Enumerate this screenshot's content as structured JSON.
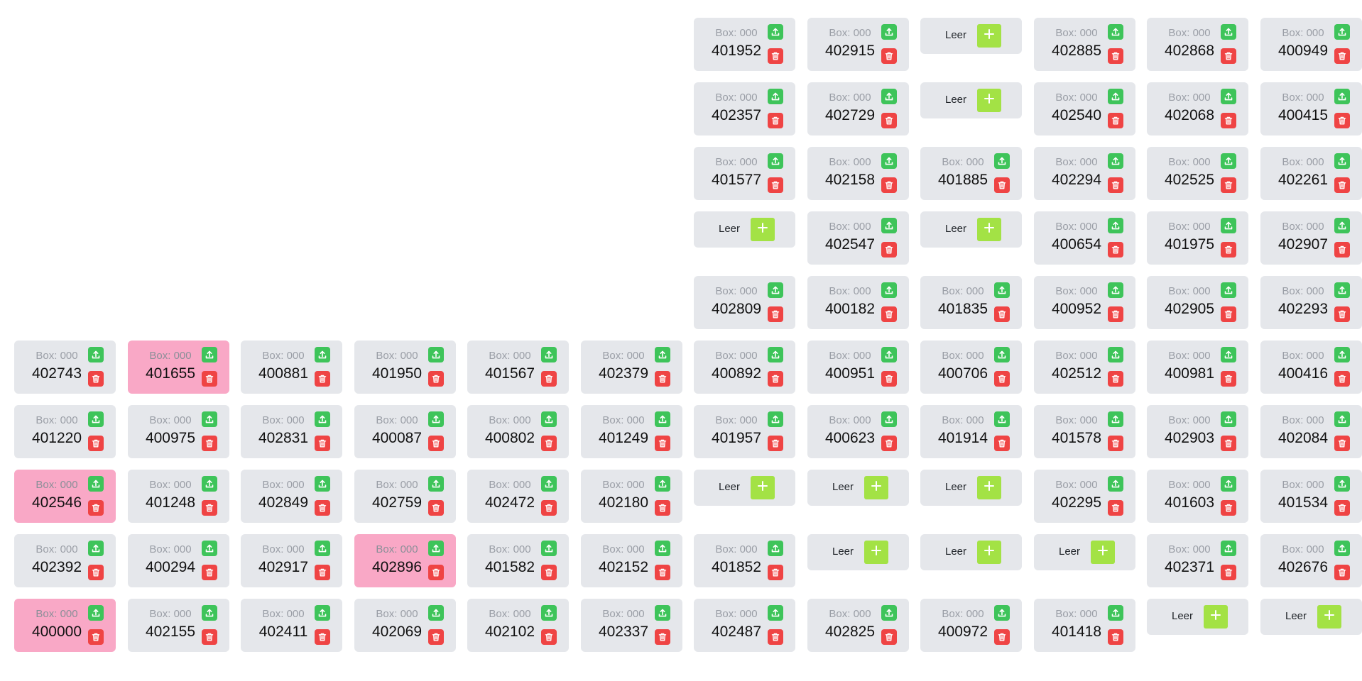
{
  "box_label": "Box: 000",
  "empty_label": "Leer",
  "icons": {
    "upload": "upload-icon",
    "delete": "trash-icon",
    "add": "plus-icon"
  },
  "colors": {
    "cell_bg": "#e5e7eb",
    "cell_highlight": "#f9a8c6",
    "upload_button": "#3ec45a",
    "delete_button": "#ef4444",
    "add_button": "#a3e245"
  },
  "grid": {
    "columns": 12,
    "rows": 10,
    "cells": [
      {
        "row": 0,
        "col": 6,
        "number": "401952"
      },
      {
        "row": 0,
        "col": 7,
        "number": "402915"
      },
      {
        "row": 0,
        "col": 8,
        "empty": true
      },
      {
        "row": 0,
        "col": 9,
        "number": "402885"
      },
      {
        "row": 0,
        "col": 10,
        "number": "402868"
      },
      {
        "row": 0,
        "col": 11,
        "number": "400949"
      },
      {
        "row": 1,
        "col": 6,
        "number": "402357"
      },
      {
        "row": 1,
        "col": 7,
        "number": "402729"
      },
      {
        "row": 1,
        "col": 8,
        "empty": true
      },
      {
        "row": 1,
        "col": 9,
        "number": "402540"
      },
      {
        "row": 1,
        "col": 10,
        "number": "402068"
      },
      {
        "row": 1,
        "col": 11,
        "number": "400415"
      },
      {
        "row": 2,
        "col": 6,
        "number": "401577"
      },
      {
        "row": 2,
        "col": 7,
        "number": "402158"
      },
      {
        "row": 2,
        "col": 8,
        "number": "401885"
      },
      {
        "row": 2,
        "col": 9,
        "number": "402294"
      },
      {
        "row": 2,
        "col": 10,
        "number": "402525"
      },
      {
        "row": 2,
        "col": 11,
        "number": "402261"
      },
      {
        "row": 3,
        "col": 6,
        "empty": true
      },
      {
        "row": 3,
        "col": 7,
        "number": "402547"
      },
      {
        "row": 3,
        "col": 8,
        "empty": true
      },
      {
        "row": 3,
        "col": 9,
        "number": "400654"
      },
      {
        "row": 3,
        "col": 10,
        "number": "401975"
      },
      {
        "row": 3,
        "col": 11,
        "number": "402907"
      },
      {
        "row": 4,
        "col": 6,
        "number": "402809"
      },
      {
        "row": 4,
        "col": 7,
        "number": "400182"
      },
      {
        "row": 4,
        "col": 8,
        "number": "401835"
      },
      {
        "row": 4,
        "col": 9,
        "number": "400952"
      },
      {
        "row": 4,
        "col": 10,
        "number": "402905"
      },
      {
        "row": 4,
        "col": 11,
        "number": "402293"
      },
      {
        "row": 5,
        "col": 0,
        "number": "402743"
      },
      {
        "row": 5,
        "col": 1,
        "number": "401655",
        "highlight": true
      },
      {
        "row": 5,
        "col": 2,
        "number": "400881"
      },
      {
        "row": 5,
        "col": 3,
        "number": "401950"
      },
      {
        "row": 5,
        "col": 4,
        "number": "401567"
      },
      {
        "row": 5,
        "col": 5,
        "number": "402379"
      },
      {
        "row": 5,
        "col": 6,
        "number": "400892"
      },
      {
        "row": 5,
        "col": 7,
        "number": "400951"
      },
      {
        "row": 5,
        "col": 8,
        "number": "400706"
      },
      {
        "row": 5,
        "col": 9,
        "number": "402512"
      },
      {
        "row": 5,
        "col": 10,
        "number": "400981"
      },
      {
        "row": 5,
        "col": 11,
        "number": "400416"
      },
      {
        "row": 6,
        "col": 0,
        "number": "401220"
      },
      {
        "row": 6,
        "col": 1,
        "number": "400975"
      },
      {
        "row": 6,
        "col": 2,
        "number": "402831"
      },
      {
        "row": 6,
        "col": 3,
        "number": "400087"
      },
      {
        "row": 6,
        "col": 4,
        "number": "400802"
      },
      {
        "row": 6,
        "col": 5,
        "number": "401249"
      },
      {
        "row": 6,
        "col": 6,
        "number": "401957"
      },
      {
        "row": 6,
        "col": 7,
        "number": "400623"
      },
      {
        "row": 6,
        "col": 8,
        "number": "401914"
      },
      {
        "row": 6,
        "col": 9,
        "number": "401578"
      },
      {
        "row": 6,
        "col": 10,
        "number": "402903"
      },
      {
        "row": 6,
        "col": 11,
        "number": "402084"
      },
      {
        "row": 7,
        "col": 0,
        "number": "402546",
        "highlight": true
      },
      {
        "row": 7,
        "col": 1,
        "number": "401248"
      },
      {
        "row": 7,
        "col": 2,
        "number": "402849"
      },
      {
        "row": 7,
        "col": 3,
        "number": "402759"
      },
      {
        "row": 7,
        "col": 4,
        "number": "402472"
      },
      {
        "row": 7,
        "col": 5,
        "number": "402180"
      },
      {
        "row": 7,
        "col": 6,
        "empty": true
      },
      {
        "row": 7,
        "col": 7,
        "empty": true
      },
      {
        "row": 7,
        "col": 8,
        "empty": true
      },
      {
        "row": 7,
        "col": 9,
        "number": "402295"
      },
      {
        "row": 7,
        "col": 10,
        "number": "401603"
      },
      {
        "row": 7,
        "col": 11,
        "number": "401534"
      },
      {
        "row": 8,
        "col": 0,
        "number": "402392"
      },
      {
        "row": 8,
        "col": 1,
        "number": "400294"
      },
      {
        "row": 8,
        "col": 2,
        "number": "402917"
      },
      {
        "row": 8,
        "col": 3,
        "number": "402896",
        "highlight": true
      },
      {
        "row": 8,
        "col": 4,
        "number": "401582"
      },
      {
        "row": 8,
        "col": 5,
        "number": "402152"
      },
      {
        "row": 8,
        "col": 6,
        "number": "401852"
      },
      {
        "row": 8,
        "col": 7,
        "empty": true
      },
      {
        "row": 8,
        "col": 8,
        "empty": true
      },
      {
        "row": 8,
        "col": 9,
        "empty": true
      },
      {
        "row": 8,
        "col": 10,
        "number": "402371"
      },
      {
        "row": 8,
        "col": 11,
        "number": "402676"
      },
      {
        "row": 9,
        "col": 0,
        "number": "400000",
        "highlight": true
      },
      {
        "row": 9,
        "col": 1,
        "number": "402155"
      },
      {
        "row": 9,
        "col": 2,
        "number": "402411"
      },
      {
        "row": 9,
        "col": 3,
        "number": "402069"
      },
      {
        "row": 9,
        "col": 4,
        "number": "402102"
      },
      {
        "row": 9,
        "col": 5,
        "number": "402337"
      },
      {
        "row": 9,
        "col": 6,
        "number": "402487"
      },
      {
        "row": 9,
        "col": 7,
        "number": "402825"
      },
      {
        "row": 9,
        "col": 8,
        "number": "400972"
      },
      {
        "row": 9,
        "col": 9,
        "number": "401418"
      },
      {
        "row": 9,
        "col": 10,
        "empty": true
      },
      {
        "row": 9,
        "col": 11,
        "empty": true
      }
    ]
  }
}
